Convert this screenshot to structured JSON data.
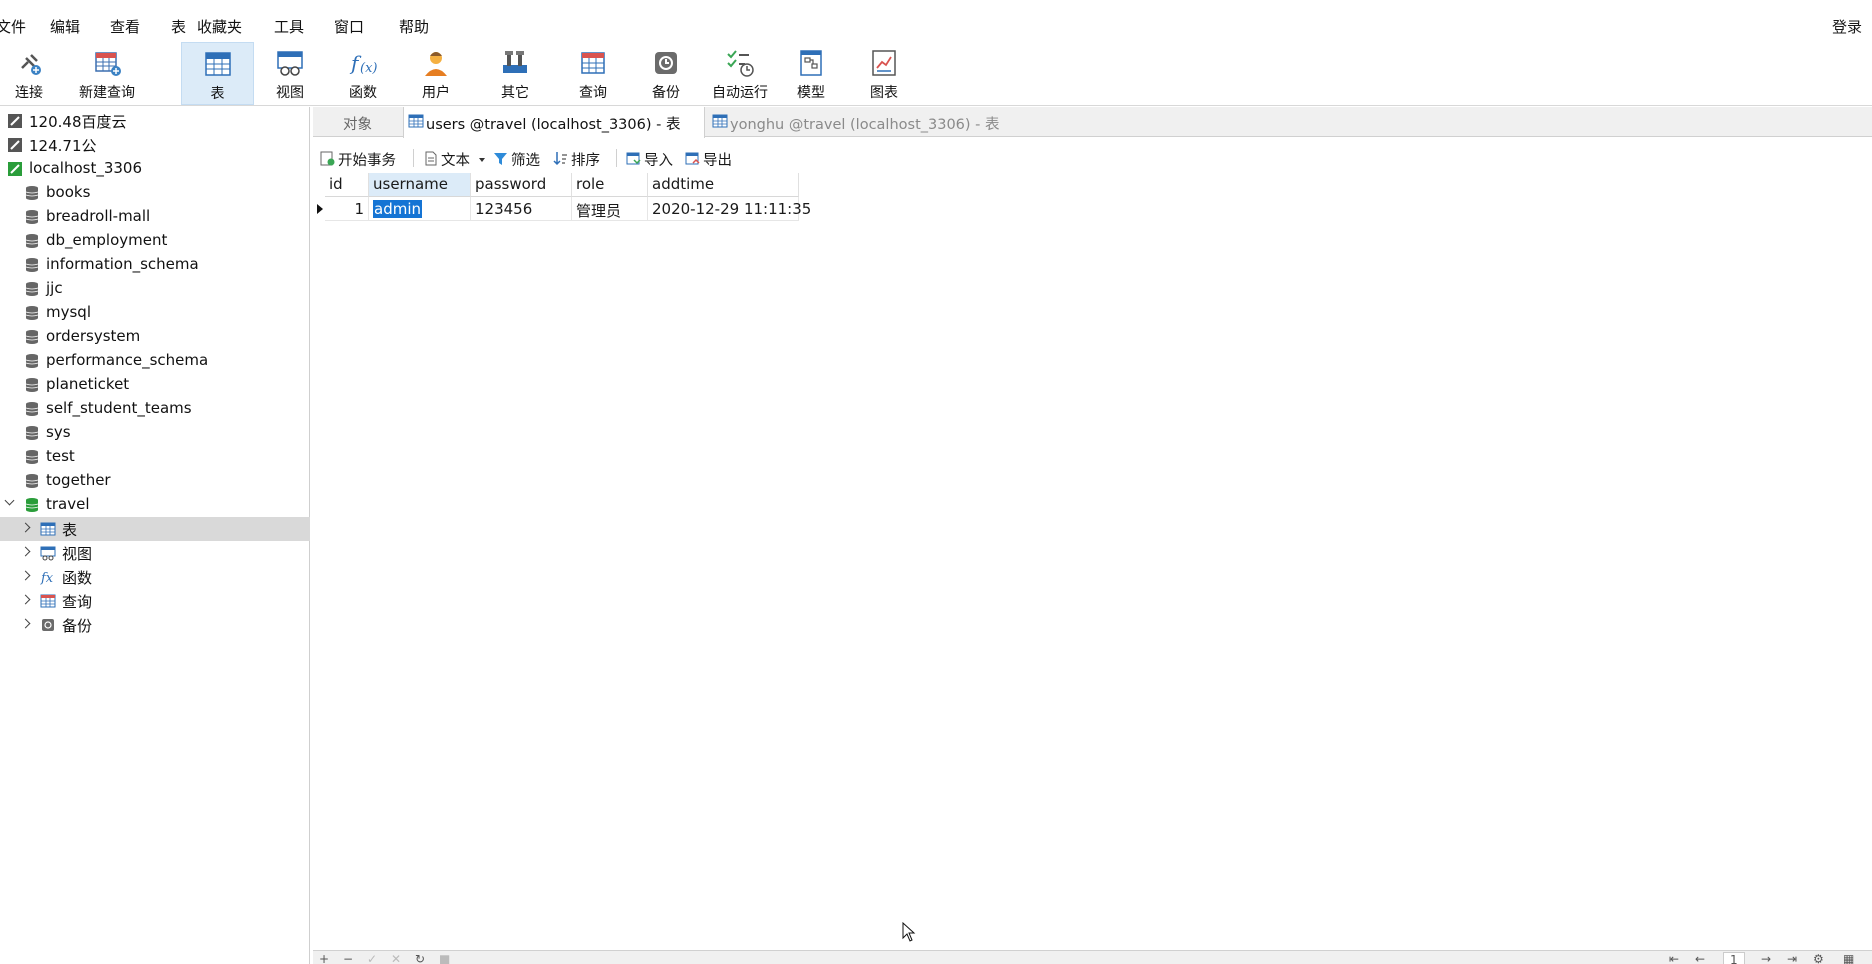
{
  "menubar": {
    "items": [
      "文件",
      "编辑",
      "查看",
      "表",
      "收藏夹",
      "工具",
      "窗口",
      "帮助"
    ],
    "login": "登录"
  },
  "toolbar": {
    "items": [
      {
        "label": "连接",
        "icon": "plug-icon"
      },
      {
        "label": "新建查询",
        "icon": "new-query-icon"
      },
      {
        "label": "表",
        "icon": "table-icon",
        "active": true
      },
      {
        "label": "视图",
        "icon": "view-icon"
      },
      {
        "label": "函数",
        "icon": "function-icon"
      },
      {
        "label": "用户",
        "icon": "user-icon"
      },
      {
        "label": "其它",
        "icon": "tools-icon"
      },
      {
        "label": "查询",
        "icon": "query-icon"
      },
      {
        "label": "备份",
        "icon": "backup-icon"
      },
      {
        "label": "自动运行",
        "icon": "schedule-icon"
      },
      {
        "label": "模型",
        "icon": "model-icon"
      },
      {
        "label": "图表",
        "icon": "chart-icon"
      }
    ]
  },
  "sidebar": {
    "connections": [
      "120.48百度云",
      "124.71公",
      "localhost_3306"
    ],
    "databases": [
      "books",
      "breadroll-mall",
      "db_employment",
      "information_schema",
      "jjc",
      "mysql",
      "ordersystem",
      "performance_schema",
      "planeticket",
      "self_student_teams",
      "sys",
      "test",
      "together",
      "travel"
    ],
    "travel_children": [
      "表",
      "视图",
      "函数",
      "查询",
      "备份"
    ]
  },
  "tabs": {
    "objects": "对象",
    "active": "users @travel (localhost_3306) - 表",
    "inactive": "yonghu @travel (localhost_3306) - 表"
  },
  "objbar": {
    "begin_transaction": "开始事务",
    "text": "文本",
    "filter": "筛选",
    "sort": "排序",
    "import": "导入",
    "export": "导出"
  },
  "grid": {
    "columns": [
      "id",
      "username",
      "password",
      "role",
      "addtime"
    ],
    "rows": [
      [
        "1",
        "admin",
        "123456",
        "管理员",
        "2020-12-29 11:11:35"
      ]
    ]
  },
  "bottombar": {
    "page": "1"
  },
  "colors": {
    "accent": "#1574d4",
    "active_tool_bg": "#dcebf8",
    "db_green": "#2a9d3a"
  }
}
